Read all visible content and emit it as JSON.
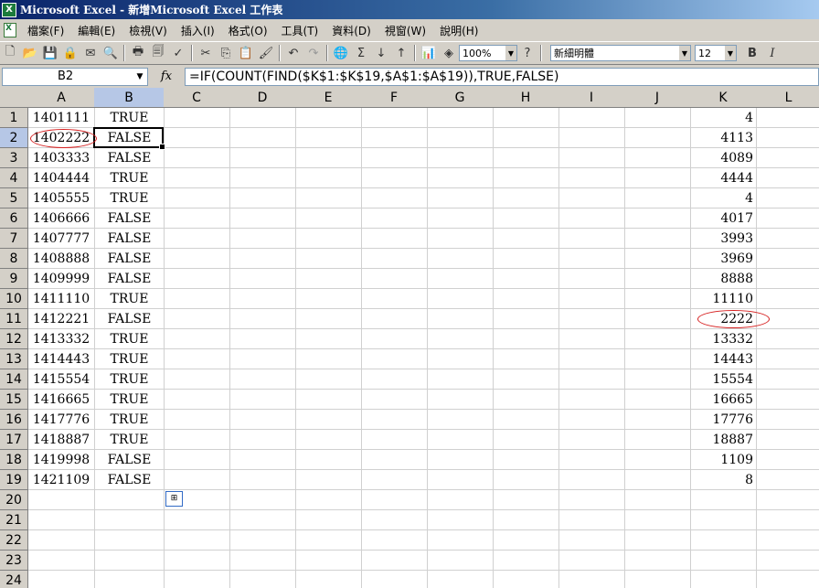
{
  "window": {
    "title": "Microsoft Excel - 新增Microsoft Excel 工作表"
  },
  "menu": [
    "檔案(F)",
    "編輯(E)",
    "檢視(V)",
    "插入(I)",
    "格式(O)",
    "工具(T)",
    "資料(D)",
    "視窗(W)",
    "說明(H)"
  ],
  "toolbar": {
    "zoom": "100%",
    "font": "新細明體",
    "size": "12",
    "bold": "B",
    "italic": "I"
  },
  "namebox": "B2",
  "fx_label": "fx",
  "formula": "=IF(COUNT(FIND($K$1:$K$19,$A$1:$A$19)),TRUE,FALSE)",
  "columns": [
    "A",
    "B",
    "C",
    "D",
    "E",
    "F",
    "G",
    "H",
    "I",
    "J",
    "K",
    "L"
  ],
  "rows": [
    "1",
    "2",
    "3",
    "4",
    "5",
    "6",
    "7",
    "8",
    "9",
    "10",
    "11",
    "12",
    "13",
    "14",
    "15",
    "16",
    "17",
    "18",
    "19",
    "20",
    "21",
    "22",
    "23",
    "24"
  ],
  "col_a": [
    "1401111",
    "1402222",
    "1403333",
    "1404444",
    "1405555",
    "1406666",
    "1407777",
    "1408888",
    "1409999",
    "1411110",
    "1412221",
    "1413332",
    "1414443",
    "1415554",
    "1416665",
    "1417776",
    "1418887",
    "1419998",
    "1421109"
  ],
  "col_b": [
    "TRUE",
    "FALSE",
    "FALSE",
    "TRUE",
    "TRUE",
    "FALSE",
    "FALSE",
    "FALSE",
    "FALSE",
    "TRUE",
    "FALSE",
    "TRUE",
    "TRUE",
    "TRUE",
    "TRUE",
    "TRUE",
    "TRUE",
    "FALSE",
    "FALSE"
  ],
  "col_k": [
    "4",
    "4113",
    "4089",
    "4444",
    "4",
    "4017",
    "3993",
    "3969",
    "8888",
    "11110",
    "2222",
    "13332",
    "14443",
    "15554",
    "16665",
    "17776",
    "18887",
    "1109",
    "8"
  ],
  "colors": {
    "title_bar": "#0a246a",
    "annotation": "#d62020",
    "selected_header": "#b6c7e6"
  }
}
